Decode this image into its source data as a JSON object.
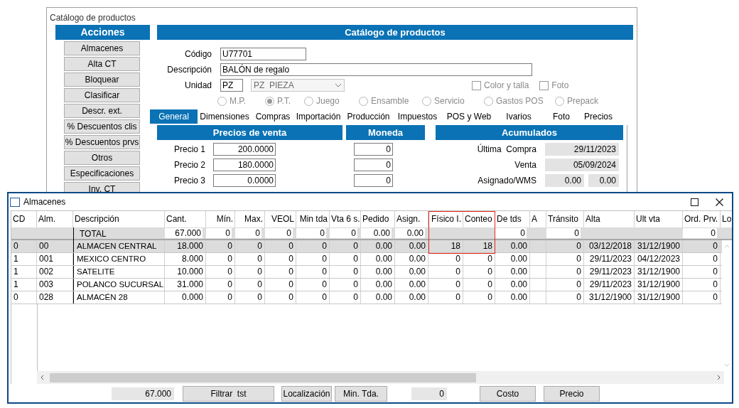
{
  "main_window": {
    "title": "Catálogo de productos",
    "actions": {
      "title": "Acciones",
      "buttons": [
        "Almacenes",
        "Alta CT",
        "Bloquear",
        "Clasificar",
        "Descr. ext.",
        "% Descuentos clis",
        "% Descuentos prvs",
        "Otros",
        "Especificaciones",
        "Inv. CT"
      ]
    },
    "header": "Catálogo de productos",
    "form": {
      "codigo": {
        "label": "Código",
        "value": "U77701"
      },
      "descripcion": {
        "label": "Descripción",
        "value": "BALÓN de regalo"
      },
      "unidad": {
        "label": "Unidad",
        "code": "PZ",
        "select": "PZ  PIEZA"
      },
      "checkboxes": [
        {
          "label": "Color y talla",
          "checked": false
        },
        {
          "label": "Foto",
          "checked": false
        }
      ],
      "radios": [
        {
          "label": "M.P.",
          "selected": false
        },
        {
          "label": "P.T.",
          "selected": true
        },
        {
          "label": "Juego",
          "selected": false
        },
        {
          "label": "Ensamble",
          "selected": false
        },
        {
          "label": "Servicio",
          "selected": false
        },
        {
          "label": "Gastos POS",
          "selected": false
        },
        {
          "label": "Prepack",
          "selected": false
        }
      ]
    },
    "tabs": [
      {
        "label": "General",
        "selected": true
      },
      {
        "label": "Dimensiones",
        "selected": false
      },
      {
        "label": "Compras",
        "selected": false
      },
      {
        "label": "Importación",
        "selected": false
      },
      {
        "label": "Producción",
        "selected": false
      },
      {
        "label": "Impuestos",
        "selected": false
      },
      {
        "label": "POS y Web",
        "selected": false
      },
      {
        "label": "Ivarios",
        "selected": false
      },
      {
        "label": "Foto",
        "selected": false
      },
      {
        "label": "Precios",
        "selected": false
      }
    ],
    "precios": {
      "title": "Precios de venta",
      "rows": [
        {
          "label": "Precio 1",
          "value": "200.0000"
        },
        {
          "label": "Precio 2",
          "value": "180.0000"
        },
        {
          "label": "Precio 3",
          "value": "0.0000"
        }
      ]
    },
    "moneda": {
      "title": "Moneda",
      "values": [
        "0",
        "0",
        "0"
      ]
    },
    "acumulados": {
      "title": "Acumulados",
      "rows": [
        {
          "label": "Última  Compra",
          "values": [
            "29/11/2023"
          ]
        },
        {
          "label": "Venta",
          "values": [
            "05/09/2024"
          ]
        },
        {
          "label": "Asignado/WMS",
          "values": [
            "0.00",
            "0.00"
          ]
        }
      ]
    }
  },
  "almacenes_window": {
    "title": "Almacenes",
    "columns": [
      {
        "label": "CD",
        "highlighted": false
      },
      {
        "label": "Alm.",
        "highlighted": false
      },
      {
        "label": "Descripción",
        "highlighted": false
      },
      {
        "label": "Cant.",
        "highlighted": false
      },
      {
        "label": "Mín.",
        "highlighted": false
      },
      {
        "label": "Max.",
        "highlighted": false
      },
      {
        "label": "VEOL",
        "highlighted": false
      },
      {
        "label": "Min tda",
        "highlighted": false
      },
      {
        "label": "Vta 6 s.",
        "highlighted": false
      },
      {
        "label": "Pedido",
        "highlighted": false
      },
      {
        "label": "Asign.",
        "highlighted": false
      },
      {
        "label": "Físico I.",
        "highlighted": true
      },
      {
        "label": "Conteo",
        "highlighted": true
      },
      {
        "label": "De tds",
        "highlighted": false
      },
      {
        "label": "A",
        "highlighted": false
      },
      {
        "label": "Tránsito",
        "highlighted": false
      },
      {
        "label": "Alta",
        "highlighted": false
      },
      {
        "label": "Ult vta",
        "highlighted": false
      },
      {
        "label": "Ord. Prv.",
        "highlighted": false
      },
      {
        "label": "Lo",
        "highlighted": false
      }
    ],
    "total": {
      "label": "TOTAL",
      "values": [
        {
          "kind": "box",
          "text": "67.000"
        },
        {
          "kind": "box",
          "text": "0"
        },
        {
          "kind": "box",
          "text": "0"
        },
        {
          "kind": "box",
          "text": "0"
        },
        {
          "kind": "box",
          "text": "0"
        },
        {
          "kind": "box",
          "text": "0"
        },
        {
          "kind": "box",
          "text": "0.00"
        },
        {
          "kind": "box",
          "text": "0.00"
        },
        {
          "kind": "empty"
        },
        {
          "kind": "empty"
        },
        {
          "kind": "box",
          "text": "0"
        },
        {
          "kind": "empty"
        },
        {
          "kind": "box",
          "text": "0"
        },
        {
          "kind": "empty"
        },
        {
          "kind": "empty"
        },
        {
          "kind": "box",
          "text": "0"
        }
      ]
    },
    "rows": [
      {
        "selected": true,
        "cells": [
          "0",
          "00",
          "ALMACEN CENTRAL",
          "18.000",
          "0",
          "0",
          "0",
          "0",
          "0",
          "0.00",
          "0.00",
          "18",
          "18",
          "0.00",
          "",
          "0",
          "03/12/2018",
          "31/12/1900",
          "0"
        ]
      },
      {
        "selected": false,
        "cells": [
          "1",
          "001",
          "MEXICO CENTRO",
          "8.000",
          "0",
          "0",
          "0",
          "0",
          "0",
          "0.00",
          "0.00",
          "0",
          "0",
          "0.00",
          "",
          "0",
          "29/11/2023",
          "04/12/2023",
          "0"
        ]
      },
      {
        "selected": false,
        "cells": [
          "1",
          "002",
          "SATELITE",
          "10.000",
          "0",
          "0",
          "0",
          "0",
          "0",
          "0.00",
          "0.00",
          "0",
          "0",
          "0.00",
          "",
          "0",
          "29/11/2023",
          "31/12/1900",
          "0"
        ]
      },
      {
        "selected": false,
        "cells": [
          "1",
          "003",
          "POLANCO SUCURSAL",
          "31.000",
          "0",
          "0",
          "0",
          "0",
          "0",
          "0.00",
          "0.00",
          "0",
          "0",
          "0.00",
          "",
          "0",
          "29/11/2023",
          "31/12/1900",
          "0"
        ]
      },
      {
        "selected": false,
        "cells": [
          "0",
          "028",
          "ALMACÉN 28",
          "0.000",
          "0",
          "0",
          "0",
          "0",
          "0",
          "0.00",
          "0.00",
          "0",
          "0",
          "0.00",
          "",
          "0",
          "31/12/1900",
          "31/12/1900",
          "0"
        ]
      }
    ],
    "footer": [
      {
        "kind": "field",
        "text": "67.000"
      },
      {
        "kind": "button",
        "text": "Filtrar  tst"
      },
      {
        "kind": "button",
        "text": "Localización"
      },
      {
        "kind": "button",
        "text": "Min. Tda."
      },
      {
        "kind": "field",
        "text": "0"
      },
      {
        "kind": "button",
        "text": "Costo"
      },
      {
        "kind": "button",
        "text": "Precio"
      }
    ]
  }
}
